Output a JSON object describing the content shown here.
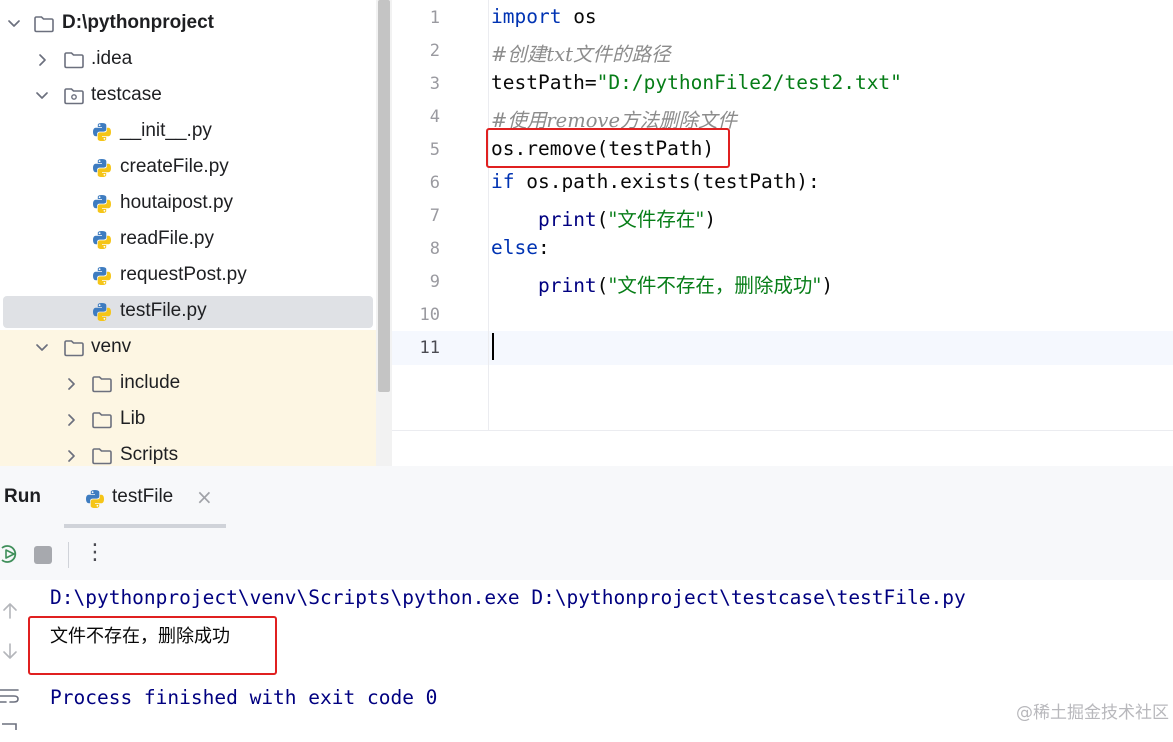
{
  "project_tree": {
    "root": "D:\\pythonproject",
    "items": [
      {
        "label": "D:\\pythonproject",
        "type": "folder",
        "expanded": true
      },
      {
        "label": ".idea",
        "type": "folder",
        "expanded": false
      },
      {
        "label": "testcase",
        "type": "package",
        "expanded": true
      },
      {
        "label": "__init__.py",
        "type": "python-file"
      },
      {
        "label": "createFile.py",
        "type": "python-file"
      },
      {
        "label": "houtaipost.py",
        "type": "python-file"
      },
      {
        "label": "readFile.py",
        "type": "python-file"
      },
      {
        "label": "requestPost.py",
        "type": "python-file"
      },
      {
        "label": "testFile.py",
        "type": "python-file",
        "selected": true
      },
      {
        "label": "venv",
        "type": "folder",
        "expanded": true
      },
      {
        "label": "include",
        "type": "folder",
        "expanded": false
      },
      {
        "label": "Lib",
        "type": "folder",
        "expanded": false
      },
      {
        "label": "Scripts",
        "type": "folder",
        "expanded": false
      }
    ]
  },
  "editor": {
    "line_numbers": [
      "1",
      "2",
      "3",
      "4",
      "5",
      "6",
      "7",
      "8",
      "9",
      "10",
      "11"
    ],
    "current_line": "11",
    "lines": {
      "l1_kw": "import",
      "l1_rest": " os",
      "l2_comment": "#创建txt文件的路径",
      "l3_name": "testPath=",
      "l3_str": "\"D:/pythonFile2/test2.txt\"",
      "l4_comment": "#使用remove方法删除文件",
      "l5_code": "os.remove(testPath)",
      "l6_kw": "if",
      "l6_rest": " os.path.exists(testPath):",
      "l7_indent": "    ",
      "l7_fn": "print",
      "l7_open": "(",
      "l7_str": "\"文件存在\"",
      "l7_close": ")",
      "l8_kw": "else",
      "l8_rest": ":",
      "l9_indent": "    ",
      "l9_fn": "print",
      "l9_open": "(",
      "l9_str": "\"文件不存在，删除成功\"",
      "l9_close": ")"
    }
  },
  "run_panel": {
    "title": "Run",
    "tab_label": "testFile",
    "tab_close": "×",
    "more_glyph": "⋮",
    "console": {
      "command": "D:\\pythonproject\\venv\\Scripts\\python.exe D:\\pythonproject\\testcase\\testFile.py",
      "output": "文件不存在，删除成功",
      "exit_message": "Process finished with exit code 0"
    }
  },
  "watermark": "@稀土掘金技术社区",
  "colors": {
    "keyword": "#0033b3",
    "string": "#067d17",
    "comment": "#8c8c8c",
    "console_text": "#000080",
    "highlight_box": "#e02020",
    "selection": "#dfe1e5",
    "venv_background": "#fdf6e3"
  },
  "icons": [
    "chevron-down-icon",
    "chevron-right-icon",
    "folder-icon",
    "package-icon",
    "python-file-icon",
    "rerun-icon",
    "stop-icon",
    "more-icon",
    "scroll-up-icon",
    "scroll-down-icon",
    "soft-wrap-icon"
  ]
}
